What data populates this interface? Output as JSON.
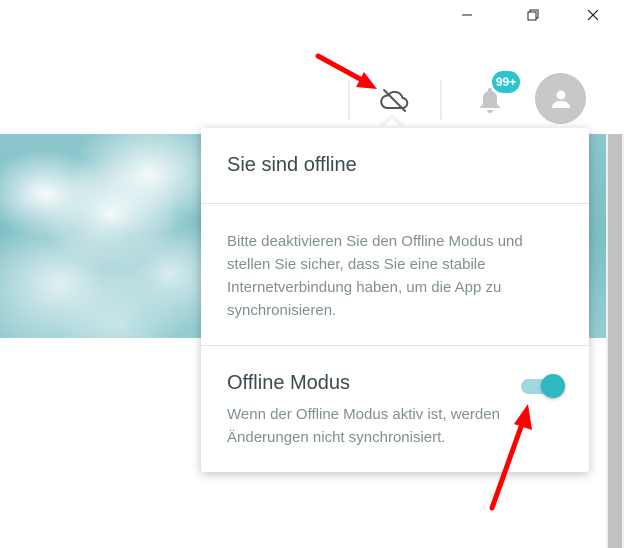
{
  "window_controls": {
    "minimize": "minimize-icon",
    "maximize": "restore-icon",
    "close": "close-icon"
  },
  "header": {
    "cloud_icon": "cloud-offline-icon",
    "bell_icon": "bell-icon",
    "notification_badge": "99+",
    "avatar_icon": "user-icon"
  },
  "popup": {
    "title": "Sie sind offline",
    "message": "Bitte deaktivieren Sie den Offline Modus und stellen Sie sicher, dass Sie eine stabile Internetverbindung haben, um die App zu synchronisieren.",
    "toggle_label": "Offline Modus",
    "toggle_description": "Wenn der Offline Modus aktiv ist, werden Änderungen nicht synchronisiert.",
    "toggle_on": true
  },
  "colors": {
    "accent": "#2ec4cf",
    "annotation": "#ff0000",
    "text_dark": "#3b4b4e",
    "text_muted": "#7f8f92"
  }
}
